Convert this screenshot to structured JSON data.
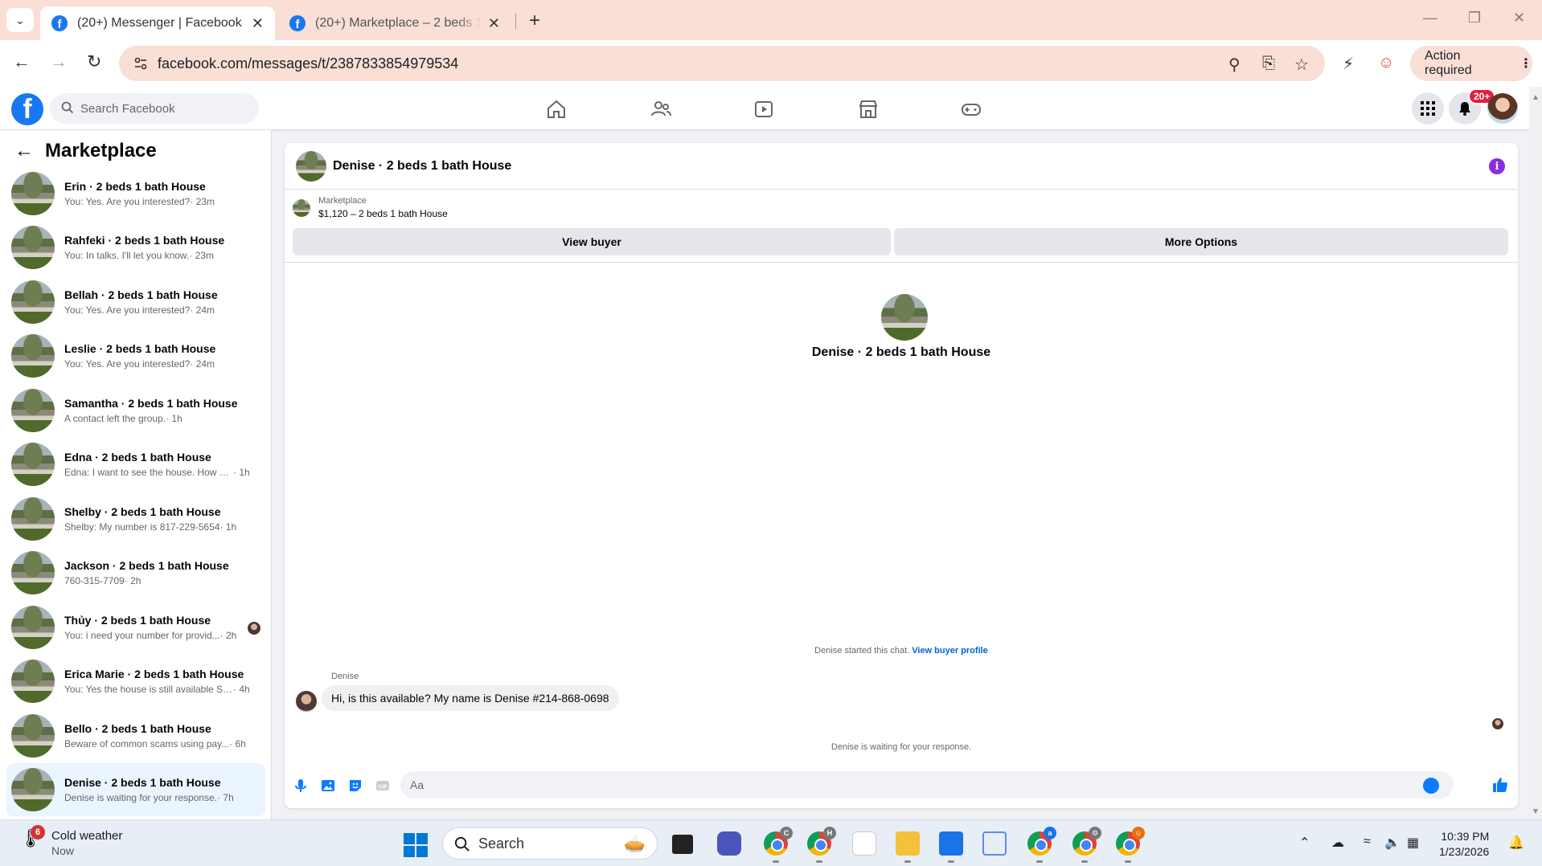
{
  "browser": {
    "tabs": [
      {
        "title": "(20+) Messenger | Facebook",
        "active": true
      },
      {
        "title": "(20+) Marketplace – 2 beds 1 bath House",
        "active": false
      }
    ],
    "url": "facebook.com/messages/t/2387833854979534",
    "action_required": "Action required"
  },
  "facebook": {
    "search_placeholder": "Search Facebook",
    "notification_badge": "20+"
  },
  "sidebar": {
    "title": "Marketplace",
    "conversations": [
      {
        "name": "Erin · 2 beds 1 bath House",
        "snippet": "You: Yes. Are you interested?",
        "time": "· 23m"
      },
      {
        "name": "Rahfeki · 2 beds 1 bath House",
        "snippet": "You: In talks. I'll let you know.",
        "time": "· 23m"
      },
      {
        "name": "Bellah · 2 beds 1 bath House",
        "snippet": "You: Yes. Are you interested?",
        "time": "· 24m"
      },
      {
        "name": "Leslie · 2 beds 1 bath House",
        "snippet": "You: Yes. Are you interested?",
        "time": "· 24m"
      },
      {
        "name": "Samantha · 2 beds 1 bath House",
        "snippet": "A contact left the group.",
        "time": "· 1h"
      },
      {
        "name": "Edna · 2 beds 1 bath House",
        "snippet": "Edna: I want to see the house. How m...",
        "time": "· 1h"
      },
      {
        "name": "Shelby · 2 beds 1 bath House",
        "snippet": "Shelby: My number is 817-229-5654",
        "time": "· 1h"
      },
      {
        "name": "Jackson · 2 beds 1 bath House",
        "snippet": "760-315-7709",
        "time": "· 2h"
      },
      {
        "name": "Thủy · 2 beds 1 bath House",
        "snippet": "You: i need your number for provid...",
        "time": "· 2h"
      },
      {
        "name": "Erica Marie · 2 beds 1 bath House",
        "snippet": "You: Yes the house is still available Se...",
        "time": "· 4h"
      },
      {
        "name": "Bello · 2 beds 1 bath House",
        "snippet": "Beware of common scams using pay...",
        "time": "· 6h"
      },
      {
        "name": "Denise · 2 beds 1 bath House",
        "snippet": "Denise is waiting for your response.",
        "time": "· 7h"
      }
    ]
  },
  "chat": {
    "header_title": "Denise · 2 beds 1 bath House",
    "marketplace_label": "Marketplace",
    "listing": "$1,120 – 2 beds 1 bath House",
    "view_buyer": "View buyer",
    "more_options": "More Options",
    "center_name": "Denise · 2 beds 1 bath House",
    "started_text": "Denise started this chat.",
    "view_buyer_profile": "View buyer profile",
    "sender": "Denise",
    "message": "Hi, is this available? My name is Denise #214-868-0698",
    "waiting": "Denise is waiting for your response.",
    "composer_placeholder": "Aa"
  },
  "taskbar": {
    "weather_badge": "6",
    "weather_title": "Cold weather",
    "weather_sub": "Now",
    "search": "Search",
    "time": "10:39 PM",
    "date": "1/23/2026"
  },
  "colors": {
    "accent": "#1877f2",
    "tabbar": "#f9dfd6",
    "selected_conv": "#ebf5ff",
    "info": "#8a2be2"
  }
}
